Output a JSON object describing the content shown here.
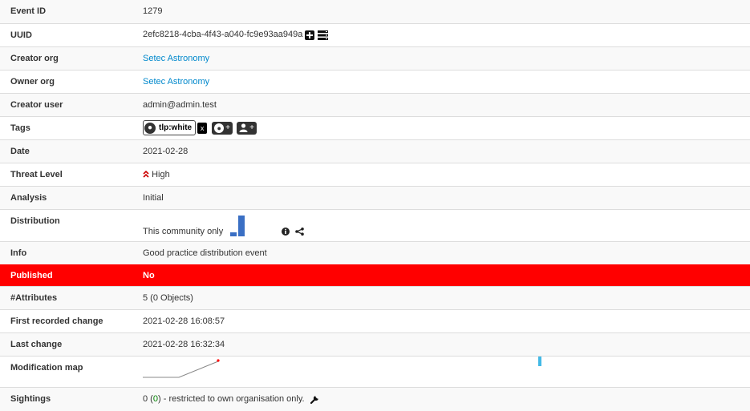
{
  "rows": {
    "event_id": {
      "label": "Event ID",
      "value": "1279"
    },
    "uuid": {
      "label": "UUID",
      "value": "2efc8218-4cba-4f43-a040-fc9e93aa949a"
    },
    "creator_org": {
      "label": "Creator org",
      "value": "Setec Astronomy"
    },
    "owner_org": {
      "label": "Owner org",
      "value": "Setec Astronomy"
    },
    "creator_user": {
      "label": "Creator user",
      "value": "admin@admin.test"
    },
    "tags": {
      "label": "Tags",
      "tag_name": "tlp:white",
      "remove_label": "x",
      "add_label": "+"
    },
    "date": {
      "label": "Date",
      "value": "2021-02-28"
    },
    "threat_level": {
      "label": "Threat Level",
      "value": "High",
      "color": "#cc0000"
    },
    "analysis": {
      "label": "Analysis",
      "value": "Initial"
    },
    "distribution": {
      "label": "Distribution",
      "value": "This community only"
    },
    "info": {
      "label": "Info",
      "value": "Good practice distribution event"
    },
    "published": {
      "label": "Published",
      "value": "No",
      "color": "#ff0000"
    },
    "attributes": {
      "label": "#Attributes",
      "value": "5 (0 Objects)"
    },
    "first_change": {
      "label": "First recorded change",
      "value": "2021-02-28 16:08:57"
    },
    "last_change": {
      "label": "Last change",
      "value": "2021-02-28 16:32:34"
    },
    "modification_map": {
      "label": "Modification map"
    },
    "sightings": {
      "label": "Sightings",
      "count": "0",
      "sub_count": "0",
      "text": "- restricted to own organisation only."
    }
  },
  "icons": {
    "uuid_actions": [
      "plus-square-icon",
      "server-icon"
    ],
    "tag_prefix": "globe-icon",
    "add_tag": "globe-icon",
    "add_user_tag": "user-icon",
    "threat": "double-chevron-up-icon",
    "distribution_info": "info-circle-icon",
    "distribution_share": "share-icon",
    "sightings": "wrench-icon"
  },
  "colors": {
    "link": "#0088cc",
    "sightings_zero": "#008000",
    "chart_bar": "#3a6fc4",
    "map_bar": "#43b9e6"
  }
}
